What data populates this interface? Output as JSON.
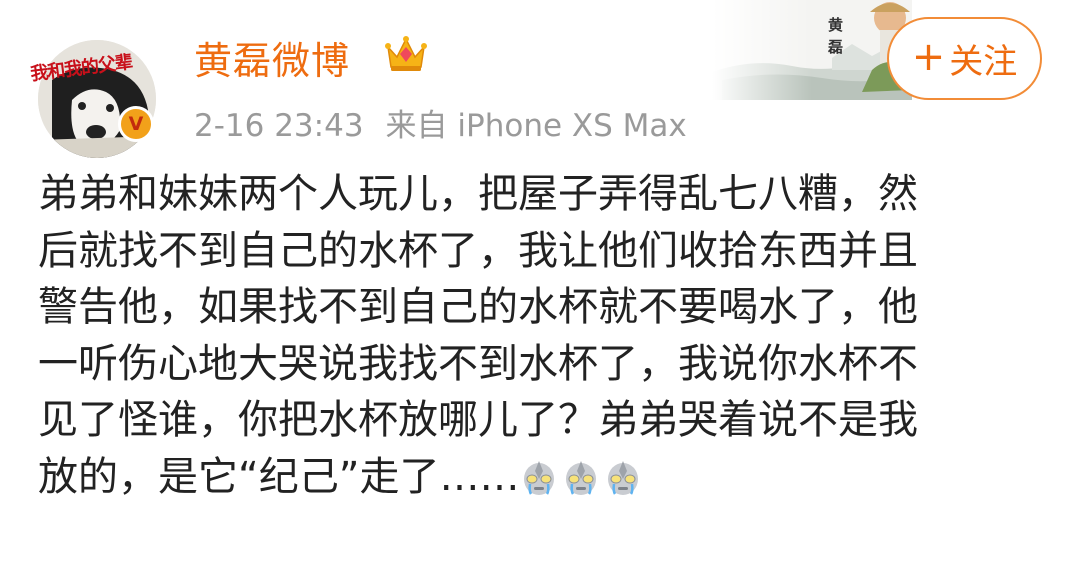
{
  "user": {
    "name": "黄磊微博",
    "avatar_caption": "我和我的父辈",
    "verified_badge": "V",
    "badge_icon": "vip-crown-icon"
  },
  "post": {
    "time": "2-16 23:43",
    "source": "来自 iPhone XS Max",
    "text_lines": [
      "弟弟和妹妹两个人玩儿，把屋子弄得乱七八糟，然",
      "后就找不到自己的水杯了，我让他们收拾东西并且",
      "警告他，如果找不到自己的水杯就不要喝水了，他",
      "一听伤心地大哭说我找不到水杯了，我说你水杯不",
      "见了怪谁，你把水杯放哪儿了？弟弟哭着说不是我",
      "放的，是它“纪己”走了……"
    ],
    "emojis": [
      "ultraman-crying-icon",
      "ultraman-crying-icon",
      "ultraman-crying-icon"
    ]
  },
  "banner": {
    "chars": "黄磊"
  },
  "follow": {
    "plus": "+",
    "label": "关注"
  },
  "colors": {
    "accent": "#ee6c10",
    "meta": "#9a9a9a",
    "text": "#222222",
    "badge": "#f2a11a"
  }
}
